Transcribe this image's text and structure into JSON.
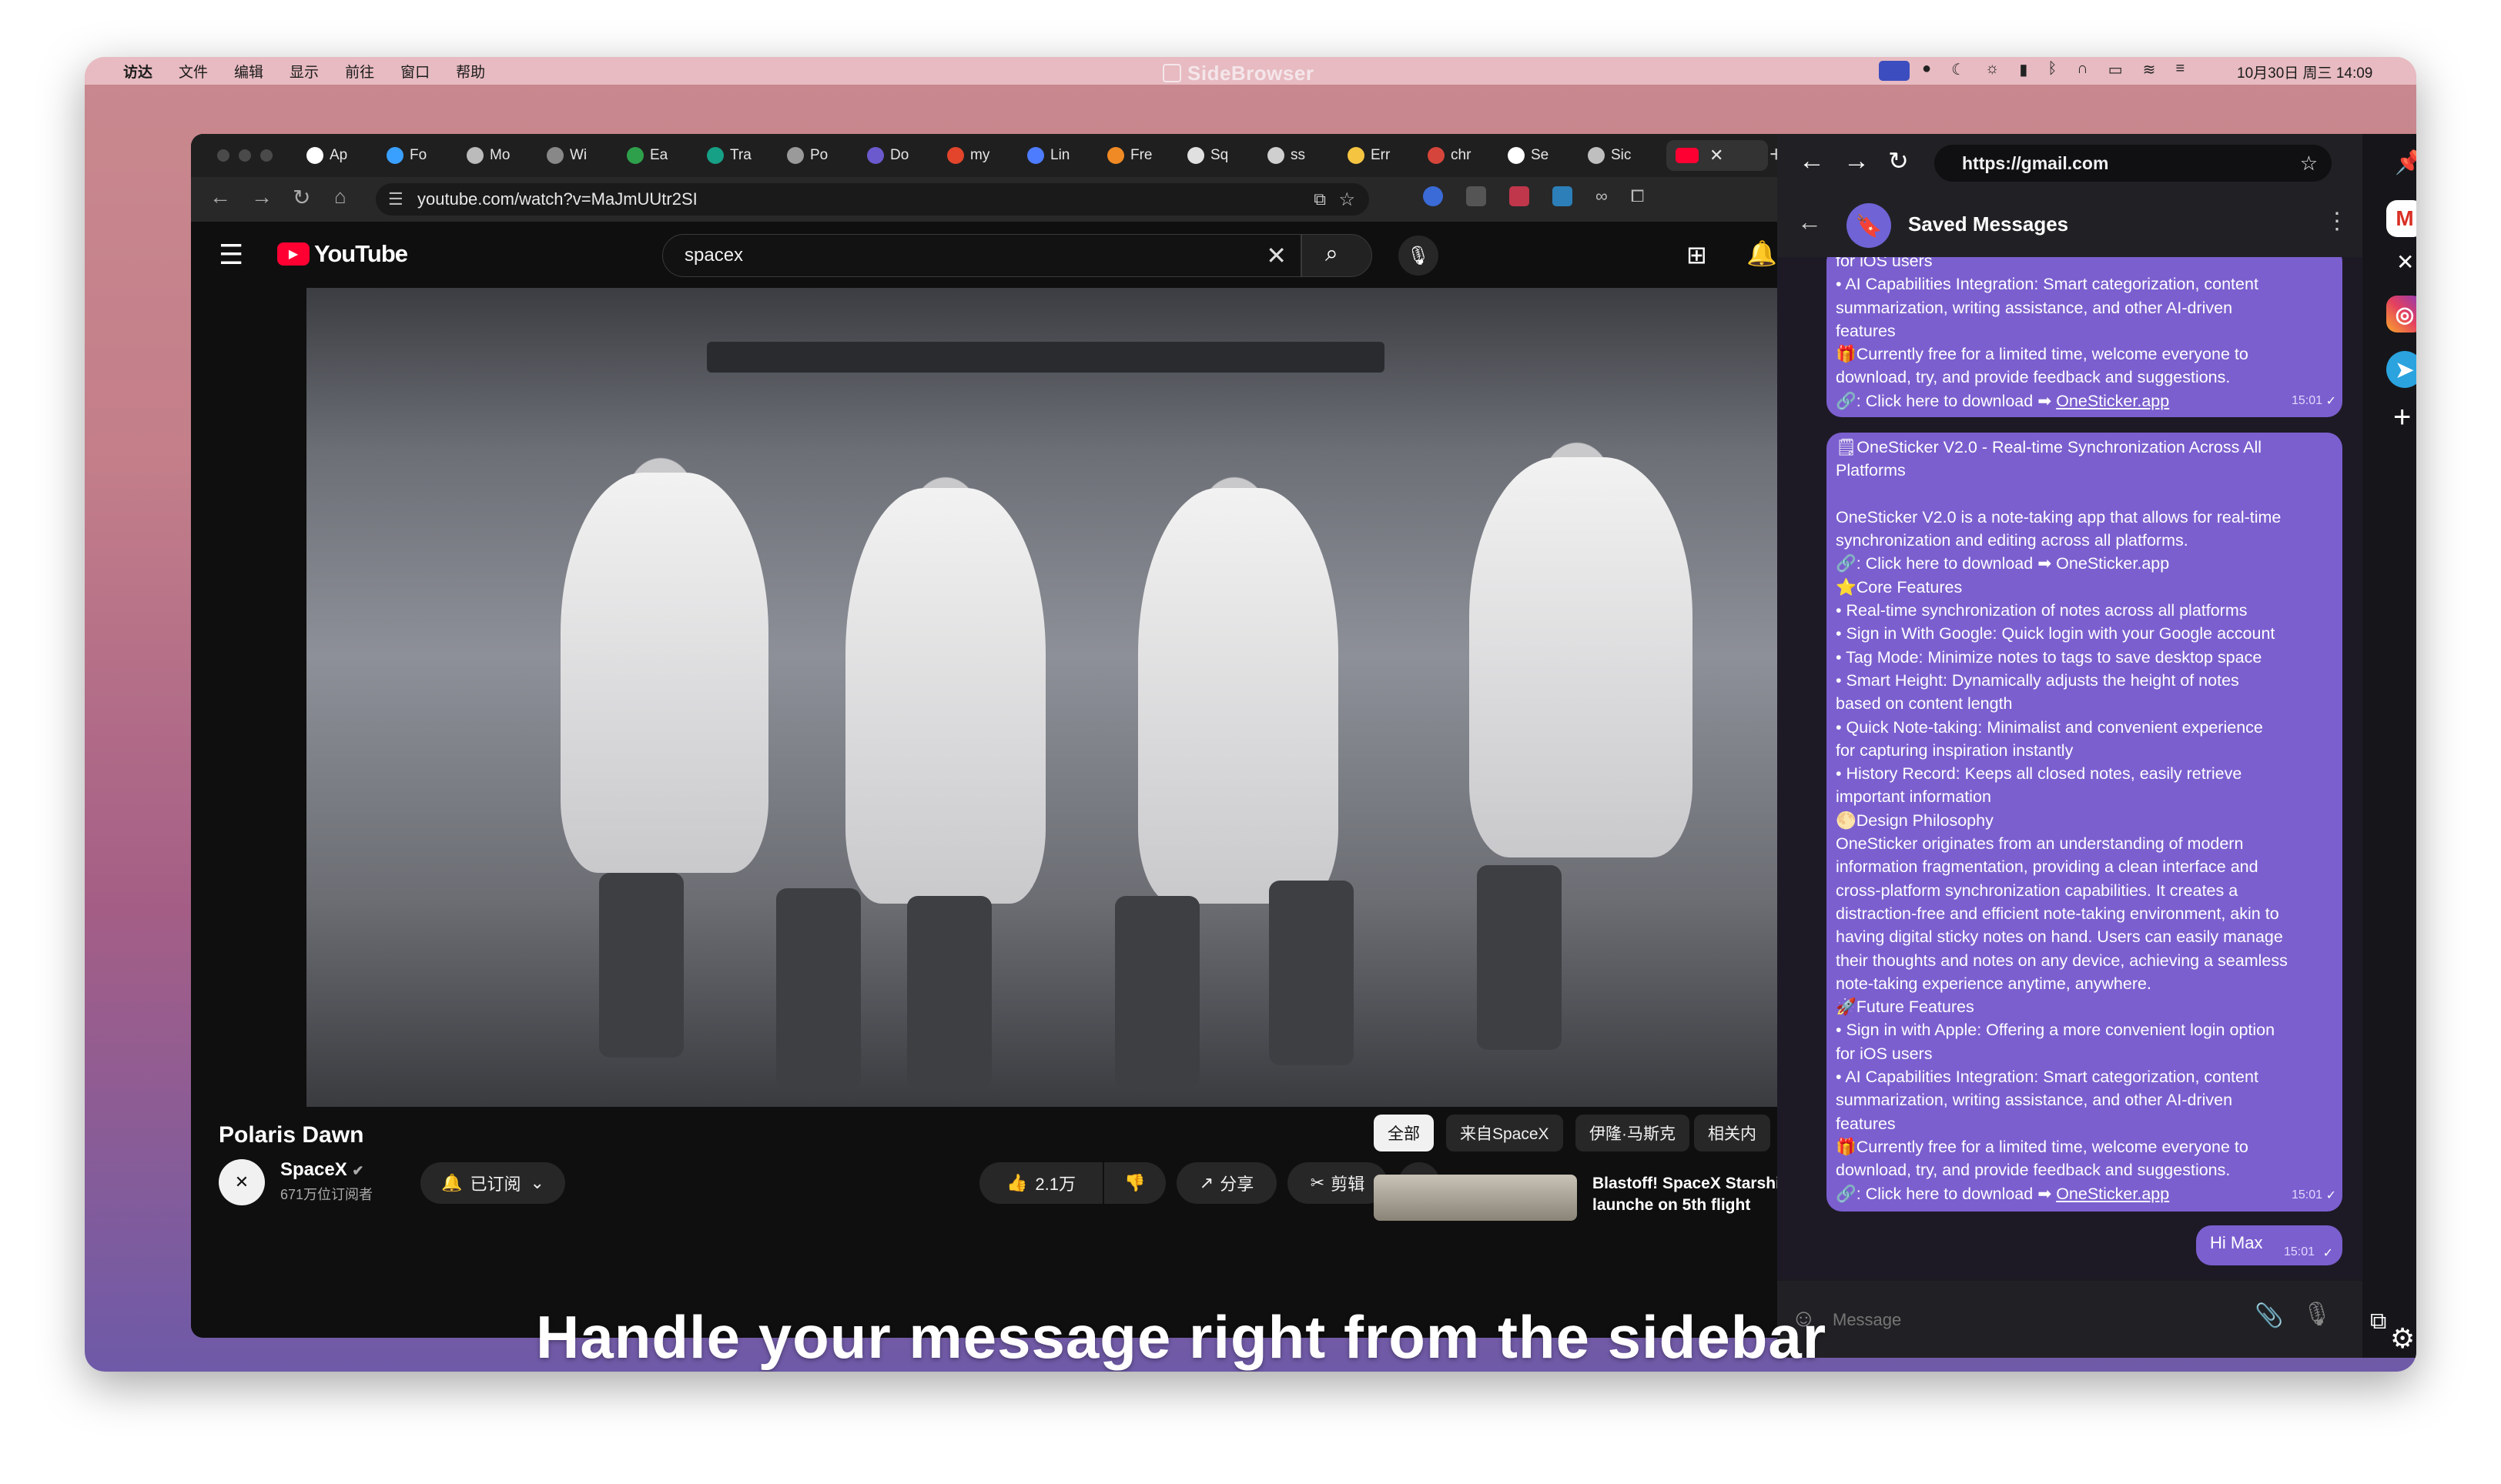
{
  "menubar": {
    "app": "访达",
    "items": [
      "文件",
      "编辑",
      "显示",
      "前往",
      "窗口",
      "帮助"
    ],
    "clock": "10月30日 周三  14:09",
    "title": "SideBrowser"
  },
  "browser": {
    "tabs": [
      {
        "label": "Ap",
        "color": "#ffffff"
      },
      {
        "label": "Fo",
        "color": "#3aa0ff"
      },
      {
        "label": "Mo",
        "color": "#bbbbbb"
      },
      {
        "label": "Wi",
        "color": "#888888"
      },
      {
        "label": "Ea",
        "color": "#2ea04b"
      },
      {
        "label": "Tra",
        "color": "#16a085"
      },
      {
        "label": "Po",
        "color": "#9a9a9a"
      },
      {
        "label": "Do",
        "color": "#6a5acd"
      },
      {
        "label": "my",
        "color": "#e2452b"
      },
      {
        "label": "Lin",
        "color": "#4d7cff"
      },
      {
        "label": "Fre",
        "color": "#f08a24"
      },
      {
        "label": "Sq",
        "color": "#e0e0e0"
      },
      {
        "label": "ss",
        "color": "#cfcfcf"
      },
      {
        "label": "Err",
        "color": "#f5c542"
      },
      {
        "label": "chr",
        "color": "#d6453b"
      },
      {
        "label": "Se",
        "color": "#ffffff"
      },
      {
        "label": "Sic",
        "color": "#bfbfbf"
      }
    ],
    "url": "youtube.com/watch?v=MaJmUUtr2SI"
  },
  "youtube": {
    "logo": "YouTube",
    "search_value": "spacex",
    "video_title": "Polaris Dawn",
    "channel": "SpaceX",
    "subscribers": "671万位订阅者",
    "subscribed_label": "已订阅",
    "likes": "2.1万",
    "share_label": "分享",
    "clip_label": "剪辑",
    "chips": [
      "全部",
      "来自SpaceX",
      "伊隆·马斯克",
      "相关内"
    ],
    "rec_title_1": "Blastoff! SpaceX Starshi",
    "rec_title_2": "launche on 5th flight"
  },
  "sidebar": {
    "url": "https://gmail.com",
    "chat_title": "Saved Messages",
    "bubble1": {
      "lines": [
        "for iOS users",
        "  • AI Capabilities Integration: Smart categorization, content",
        "summarization, writing assistance, and other AI-driven",
        "features",
        "🎁Currently free for a limited time, welcome everyone to",
        "download, try, and provide feedback and suggestions.",
        "🔗: Click here to download ➡ "
      ],
      "link": "OneSticker.app",
      "time": "15:01"
    },
    "bubble2": {
      "lines": [
        "🗒OneSticker V2.0 - Real-time Synchronization Across All",
        "Platforms",
        "",
        "OneSticker V2.0 is a note-taking app that allows for real-time",
        "synchronization and editing across all platforms.",
        "🔗: Click here to download ➡ OneSticker.app",
        "⭐Core Features",
        "  • Real-time synchronization of notes across all platforms",
        "  • Sign in With Google: Quick login with your Google account",
        "  • Tag Mode: Minimize notes to tags to save desktop space",
        "  • Smart Height: Dynamically adjusts the height of notes",
        "based on content length",
        "  • Quick Note-taking: Minimalist and convenient experience",
        "for capturing inspiration instantly",
        "  • History Record: Keeps all closed notes, easily retrieve",
        "important information",
        "🌕Design Philosophy",
        "OneSticker originates from an understanding of modern",
        "information fragmentation, providing a clean interface and",
        "cross-platform synchronization capabilities. It creates a",
        "distraction-free and efficient note-taking environment, akin to",
        "having digital sticky notes on hand. Users can easily manage",
        "their thoughts and notes on any device, achieving a seamless",
        "note-taking experience anytime, anywhere.",
        "🚀Future Features",
        "  • Sign in with Apple: Offering a more convenient login option",
        "for iOS users",
        "  • AI Capabilities Integration: Smart categorization, content",
        "summarization, writing assistance, and other AI-driven",
        "features",
        "🎁Currently free for a limited time, welcome everyone to",
        "download, try, and provide feedback and suggestions.",
        "🔗: Click here to download ➡ "
      ],
      "link": "OneSticker.app",
      "time": "15:01"
    },
    "reply": {
      "text": "Hi Max",
      "time": "15:01"
    },
    "message_placeholder": "Message"
  },
  "caption": "Handle your message right from the sidebar"
}
